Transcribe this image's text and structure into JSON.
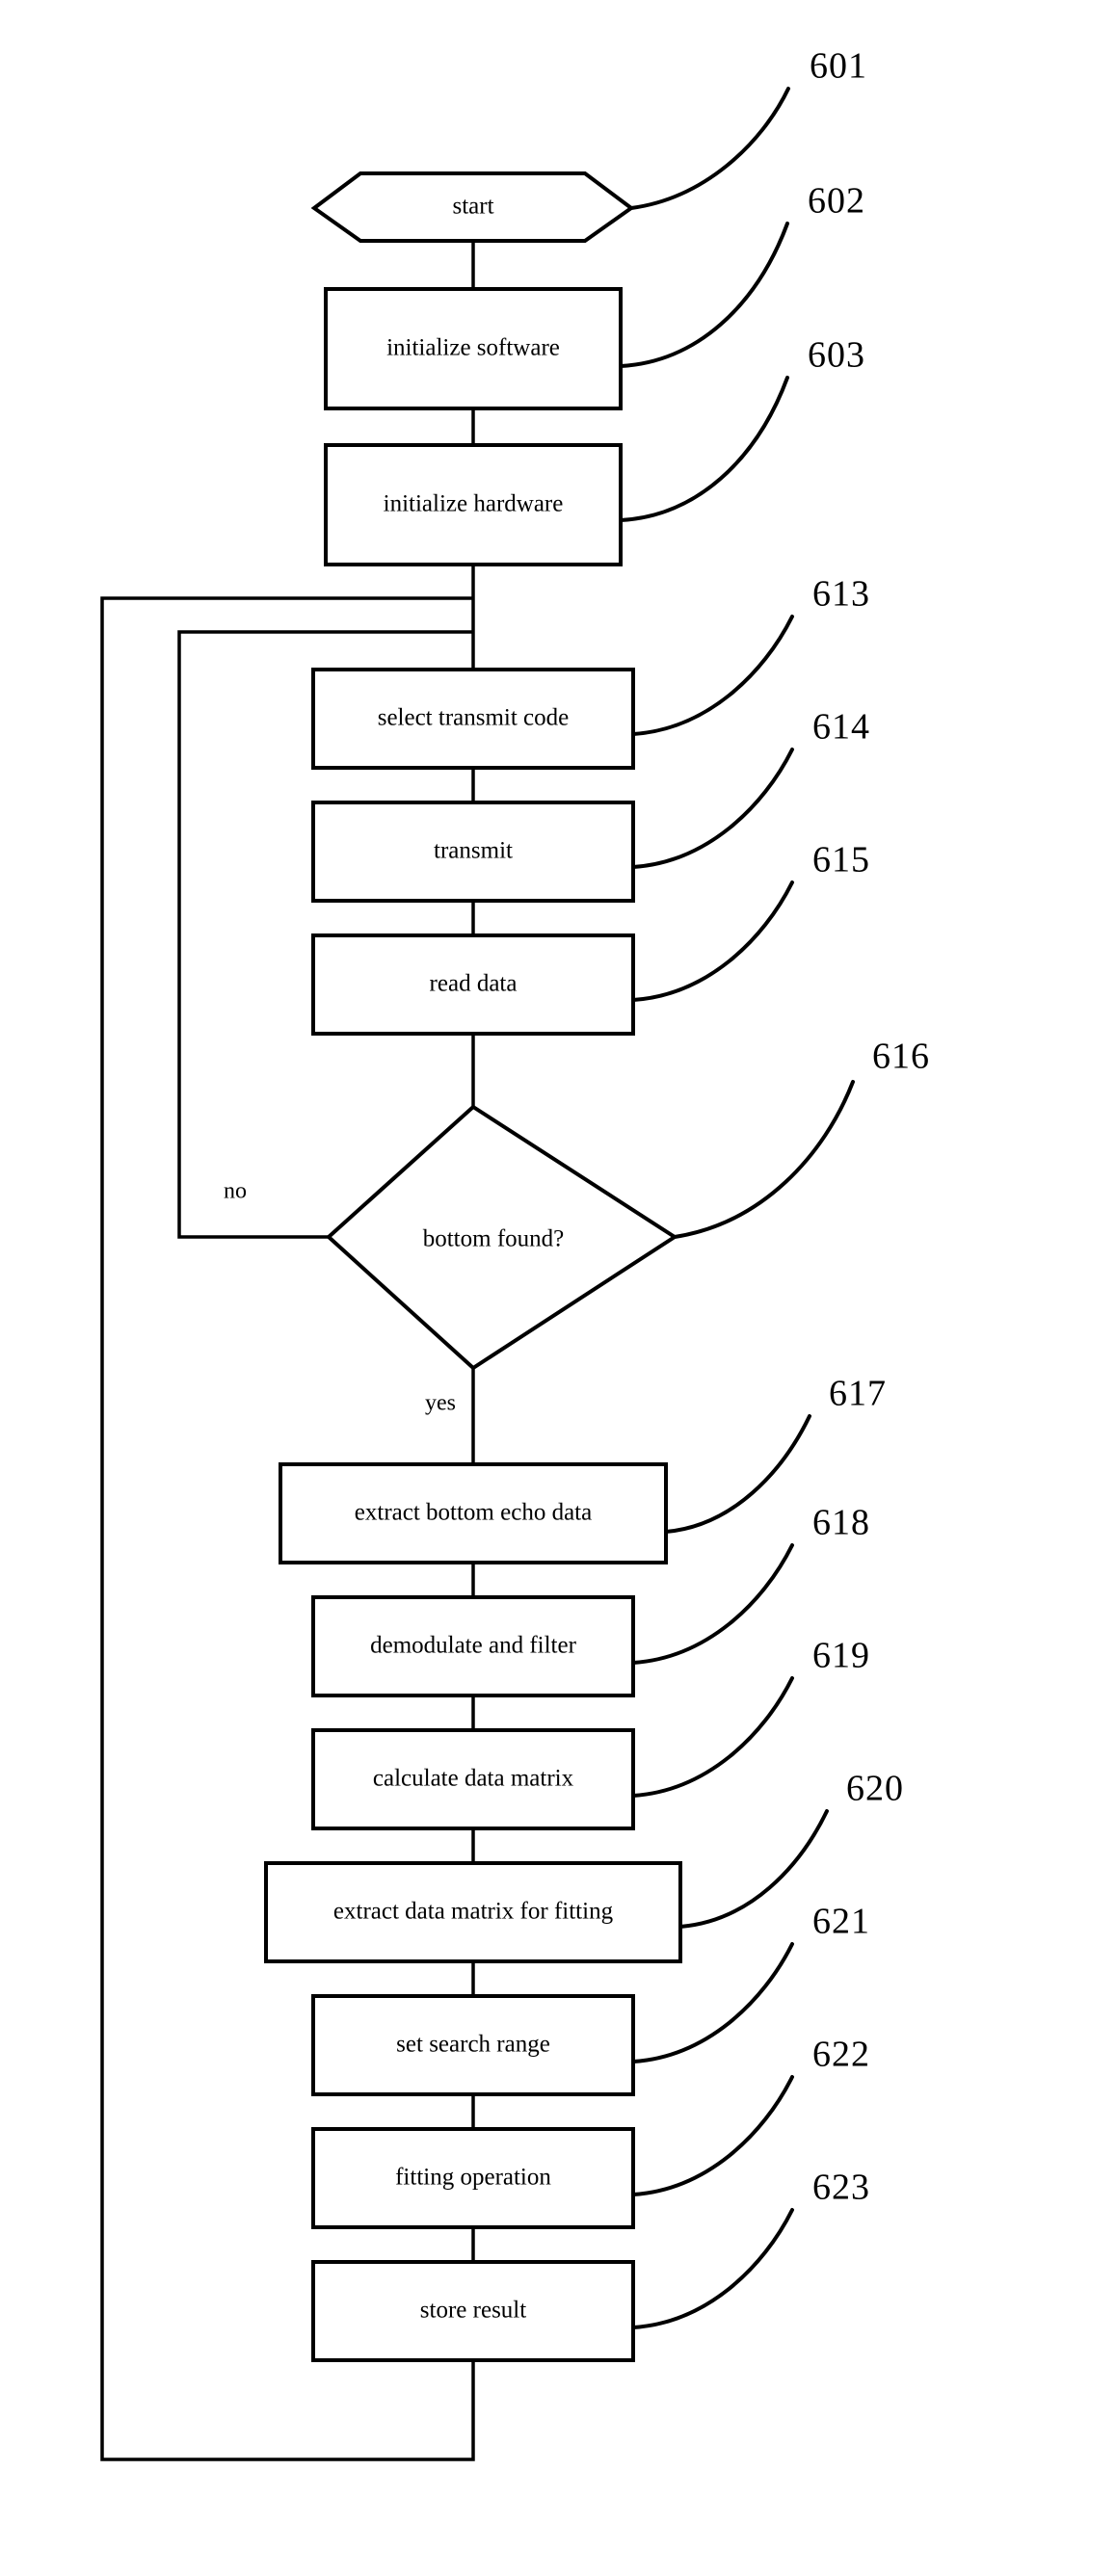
{
  "figure": {
    "type": "flowchart",
    "orientation": "vertical",
    "background_color": "#ffffff",
    "line_color": "#000000"
  },
  "nodes": [
    {
      "id": "start",
      "shape": "hexagon",
      "label": "start",
      "ref": "601"
    },
    {
      "id": "n602",
      "shape": "rectangle",
      "label": "initialize software",
      "ref": "602"
    },
    {
      "id": "n603",
      "shape": "rectangle",
      "label": "initialize hardware",
      "ref": "603"
    },
    {
      "id": "n613",
      "shape": "rectangle",
      "label": "select transmit code",
      "ref": "613"
    },
    {
      "id": "n614",
      "shape": "rectangle",
      "label": "transmit",
      "ref": "614"
    },
    {
      "id": "n615",
      "shape": "rectangle",
      "label": "read data",
      "ref": "615"
    },
    {
      "id": "n616",
      "shape": "diamond",
      "label": "bottom found?",
      "ref": "616"
    },
    {
      "id": "n617",
      "shape": "rectangle",
      "label": "extract bottom echo data",
      "ref": "617"
    },
    {
      "id": "n618",
      "shape": "rectangle",
      "label": "demodulate and filter",
      "ref": "618"
    },
    {
      "id": "n619",
      "shape": "rectangle",
      "label": "calculate data matrix",
      "ref": "619"
    },
    {
      "id": "n620",
      "shape": "rectangle",
      "label": "extract data matrix for fitting",
      "ref": "620"
    },
    {
      "id": "n621",
      "shape": "rectangle",
      "label": "set search range",
      "ref": "621"
    },
    {
      "id": "n622",
      "shape": "rectangle",
      "label": "fitting operation",
      "ref": "622"
    },
    {
      "id": "n623",
      "shape": "rectangle",
      "label": "store result",
      "ref": "623"
    }
  ],
  "branch_labels": {
    "no": "no",
    "yes": "yes"
  },
  "reference_numerals": [
    "601",
    "602",
    "603",
    "613",
    "614",
    "615",
    "616",
    "617",
    "618",
    "619",
    "620",
    "621",
    "622",
    "623"
  ]
}
